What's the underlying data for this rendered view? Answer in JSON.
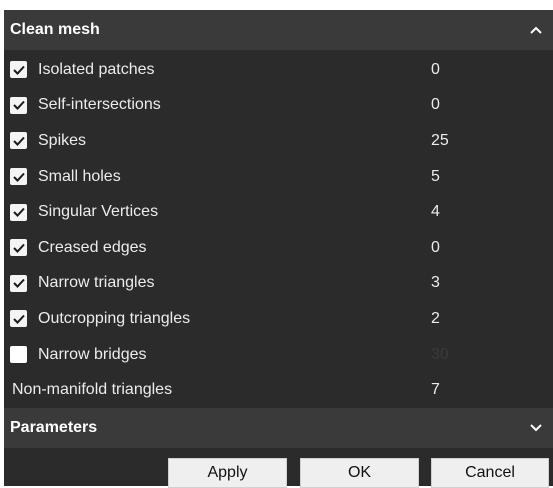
{
  "sections": {
    "clean_mesh": {
      "title": "Clean mesh",
      "icon": "chevron-up-icon"
    },
    "parameters": {
      "title": "Parameters",
      "icon": "chevron-down-icon"
    }
  },
  "rows": [
    {
      "label": "Isolated patches",
      "value": "0",
      "checked": true
    },
    {
      "label": "Self-intersections",
      "value": "0",
      "checked": true
    },
    {
      "label": "Spikes",
      "value": "25",
      "checked": true
    },
    {
      "label": "Small holes",
      "value": "5",
      "checked": true
    },
    {
      "label": "Singular Vertices",
      "value": "4",
      "checked": true
    },
    {
      "label": "Creased edges",
      "value": "0",
      "checked": true
    },
    {
      "label": "Narrow triangles",
      "value": "3",
      "checked": true
    },
    {
      "label": "Outcropping triangles",
      "value": "2",
      "checked": true
    },
    {
      "label": "Narrow bridges",
      "value": "30",
      "checked": false
    },
    {
      "label": "Non-manifold triangles",
      "value": "7",
      "checked": null
    }
  ],
  "buttons": {
    "apply": "Apply",
    "ok": "OK",
    "cancel": "Cancel"
  },
  "colors": {
    "panel_bg": "#2b2b2b",
    "header_bg": "#3a3a3a",
    "button_bg": "#efefef"
  }
}
